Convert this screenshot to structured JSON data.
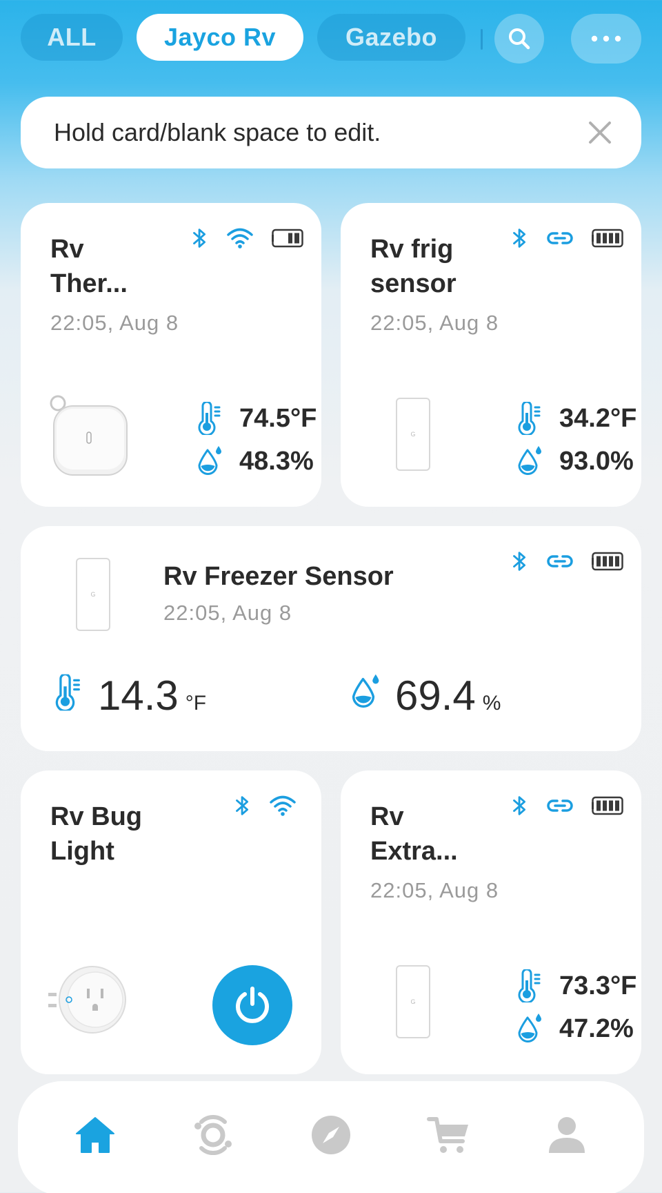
{
  "tabs": [
    {
      "label": "ALL",
      "active": false
    },
    {
      "label": "Jayco Rv",
      "active": true
    },
    {
      "label": "Gazebo",
      "active": false
    }
  ],
  "header_icons": [
    "search-icon",
    "more-icon"
  ],
  "banner": {
    "text": "Hold card/blank space to edit."
  },
  "cards": {
    "thermo": {
      "title_line1": "Rv",
      "title_line2": "Ther...",
      "time": "22:05,  Aug 8",
      "temperature": "74.5°F",
      "humidity": "48.3%",
      "connectivity": [
        "bluetooth-icon",
        "wifi-icon"
      ],
      "battery_level": 0.5
    },
    "frig": {
      "title_line1": "Rv frig",
      "title_line2": "sensor",
      "time": "22:05,  Aug 8",
      "temperature": "34.2°F",
      "humidity": "93.0%",
      "connectivity": [
        "bluetooth-icon",
        "link-icon"
      ],
      "battery_level": 1.0
    },
    "freezer": {
      "title": "Rv Freezer Sensor",
      "time": "22:05,  Aug 8",
      "temperature": "14.3",
      "temperature_unit": "°F",
      "humidity": "69.4",
      "humidity_unit": "%",
      "connectivity": [
        "bluetooth-icon",
        "link-icon"
      ],
      "battery_level": 1.0
    },
    "bug_light": {
      "title_line1": "Rv Bug",
      "title_line2": "Light",
      "connectivity": [
        "bluetooth-icon",
        "wifi-icon"
      ],
      "power_icon": "power-icon"
    },
    "extra": {
      "title_line1": "Rv",
      "title_line2": "Extra...",
      "time": "22:05,  Aug 8",
      "temperature": "73.3°F",
      "humidity": "47.2%",
      "connectivity": [
        "bluetooth-icon",
        "link-icon"
      ],
      "battery_level": 1.0
    }
  },
  "bottom_nav": [
    {
      "icon": "home-icon",
      "active": true
    },
    {
      "icon": "scenes-icon",
      "active": false
    },
    {
      "icon": "discover-icon",
      "active": false
    },
    {
      "icon": "cart-icon",
      "active": false
    },
    {
      "icon": "profile-icon",
      "active": false
    }
  ],
  "colors": {
    "accent": "#1aa3e0",
    "icon_blue": "#1b9ee0",
    "inactive_nav": "#c9c9c9",
    "text_primary": "#2b2b2b",
    "text_secondary": "#9a9a9a"
  }
}
